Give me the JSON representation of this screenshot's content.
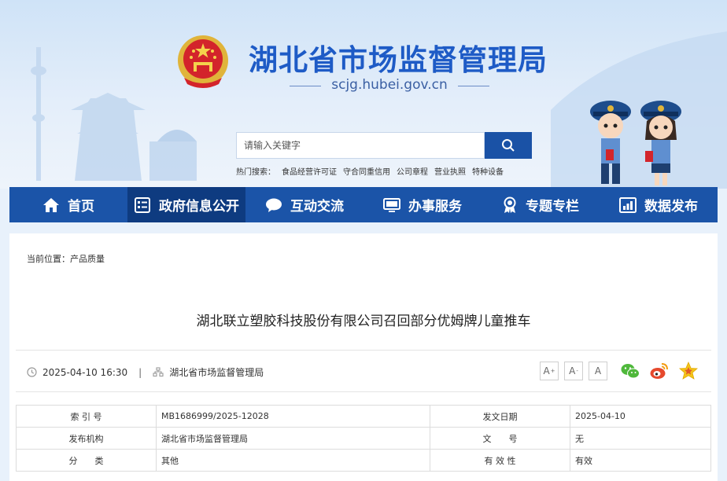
{
  "header": {
    "site_title": "湖北省市场监督管理局",
    "site_url": "scjg.hubei.gov.cn",
    "search_placeholder": "请输入关键字",
    "hot_label": "热门搜索：",
    "hot_links": [
      "食品经营许可证",
      "守合同重信用",
      "公司章程",
      "营业执照",
      "特种设备"
    ]
  },
  "nav": {
    "items": [
      {
        "label": "首页",
        "icon": "home-icon"
      },
      {
        "label": "政府信息公开",
        "icon": "document-list-icon"
      },
      {
        "label": "互动交流",
        "icon": "chat-bubble-icon"
      },
      {
        "label": "办事服务",
        "icon": "monitor-icon"
      },
      {
        "label": "专题专栏",
        "icon": "award-ribbon-icon"
      },
      {
        "label": "数据发布",
        "icon": "bar-chart-icon"
      }
    ],
    "active_index": 1
  },
  "breadcrumb": "当前位置：产品质量",
  "article": {
    "title": "湖北联立塑胶科技股份有限公司召回部分优姆牌儿童推车",
    "date": "2025-04-10 16:30",
    "separator": "|",
    "source": "湖北省市场监督管理局",
    "font_buttons": [
      "A",
      "A",
      "A"
    ],
    "font_sizes": [
      "+",
      "-",
      ""
    ],
    "share_icons": [
      "wechat-icon",
      "weibo-icon",
      "favorite-star-icon"
    ]
  },
  "info_table": {
    "rows": [
      {
        "k1": "索 引 号",
        "v1": "MB1686999/2025-12028",
        "k2": "发文日期",
        "v2": "2025-04-10"
      },
      {
        "k1": "发布机构",
        "v1": "湖北省市场监督管理局",
        "k2": "文　　号",
        "v2": "无"
      },
      {
        "k1": "分　　类",
        "v1": "其他",
        "k2": "有 效 性",
        "v2": "有效"
      }
    ]
  },
  "colors": {
    "brand_blue": "#1e5bc6",
    "nav_bg": "#1b54a8",
    "nav_active": "#0e3b80",
    "search_btn": "#1a52a6"
  }
}
